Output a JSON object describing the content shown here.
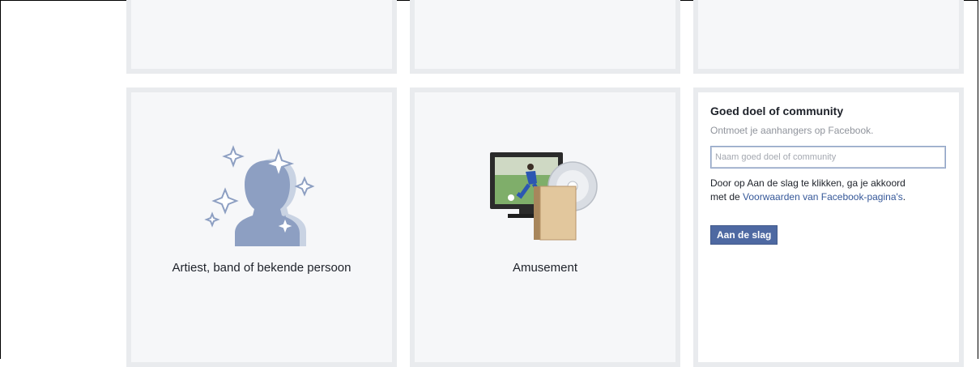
{
  "categories": [
    {
      "label": "Artiest, band of bekende persoon",
      "icon": "artist-silhouette-icon"
    },
    {
      "label": "Amusement",
      "icon": "entertainment-tv-icon"
    }
  ],
  "community": {
    "title": "Goed doel of community",
    "subtitle": "Ontmoet je aanhangers op Facebook.",
    "input_placeholder": "Naam goed doel of community",
    "terms_prefix": "Door op Aan de slag te klikken, ga je akkoord met de ",
    "terms_link": "Voorwaarden van Facebook-pagina's",
    "terms_suffix": ".",
    "button_label": "Aan de slag"
  },
  "colors": {
    "tile_bg": "#f6f7f9",
    "tile_border": "#e9ebee",
    "link": "#365899",
    "button": "#4e69a2"
  }
}
